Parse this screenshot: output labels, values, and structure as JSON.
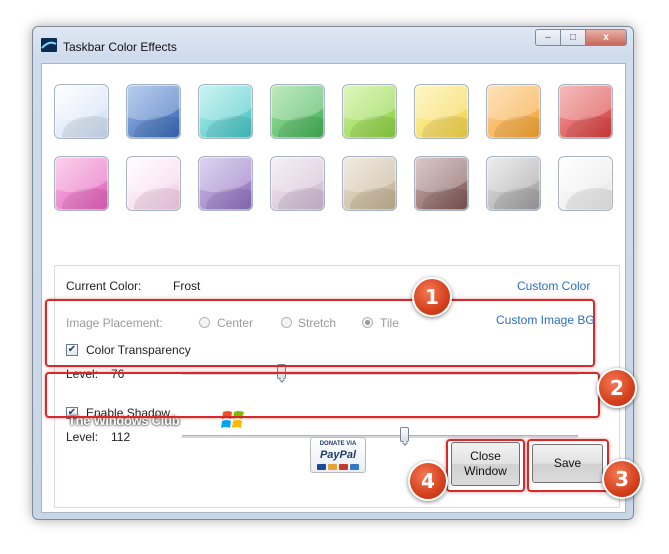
{
  "window": {
    "title": "Taskbar Color Effects",
    "buttons": {
      "minimize": "–",
      "maximize": "□",
      "close": "x"
    }
  },
  "swatches": [
    {
      "name": "frost",
      "top": "#ffffff",
      "bottom": "#c9dbf2"
    },
    {
      "name": "blue",
      "top": "#9bbbe8",
      "bottom": "#3566b5"
    },
    {
      "name": "teal",
      "top": "#b6f0ef",
      "bottom": "#3fc2c2"
    },
    {
      "name": "green",
      "top": "#a7e3a7",
      "bottom": "#3fae53"
    },
    {
      "name": "lime",
      "top": "#d4f3a2",
      "bottom": "#86cf3c"
    },
    {
      "name": "yellow",
      "top": "#fff5b0",
      "bottom": "#f2d044"
    },
    {
      "name": "orange",
      "top": "#ffd6a0",
      "bottom": "#f4a12c"
    },
    {
      "name": "red",
      "top": "#f4a3a3",
      "bottom": "#d63a3a"
    },
    {
      "name": "pink",
      "top": "#fac0e4",
      "bottom": "#e35aba"
    },
    {
      "name": "light-pink",
      "top": "#ffffff",
      "bottom": "#f5c9e6"
    },
    {
      "name": "purple",
      "top": "#d2c3ea",
      "bottom": "#8b6bbd"
    },
    {
      "name": "lavender",
      "top": "#f3ebf3",
      "bottom": "#cdb6cf"
    },
    {
      "name": "sand",
      "top": "#ece4d4",
      "bottom": "#bfae8f"
    },
    {
      "name": "brown",
      "top": "#cdb4b2",
      "bottom": "#7a5251"
    },
    {
      "name": "gray",
      "top": "#e8e8e8",
      "bottom": "#9a9a9a"
    },
    {
      "name": "white",
      "top": "#ffffff",
      "bottom": "#e5e5e5"
    }
  ],
  "settings": {
    "current_color_label": "Current Color:",
    "current_color_value": "Frost",
    "custom_color_link": "Custom Color",
    "image_placement_label": "Image Placement:",
    "placement_options": [
      "Center",
      "Stretch",
      "Tile"
    ],
    "placement_selected": "Tile",
    "custom_image_link": "Custom Image BG"
  },
  "transparency": {
    "label": "Color Transparency",
    "checked": true,
    "level_label": "Level:",
    "level_value": "76",
    "level_fraction": 0.25
  },
  "shadow": {
    "label": "Enable Shadow",
    "checked": true,
    "level_label": "Level:",
    "level_value": "112",
    "level_fraction": 0.56
  },
  "footer": {
    "logo_text": "The Windows Club",
    "paypal_donate": "DONATE VIA",
    "paypal_word": "PayPal",
    "close_button": "Close\nWindow",
    "save_button": "Save"
  },
  "badges": [
    "1",
    "2",
    "3",
    "4"
  ],
  "colors": {
    "highlight": "#d62a2a",
    "badge": "#d4401c",
    "link": "#2b6fc2"
  }
}
